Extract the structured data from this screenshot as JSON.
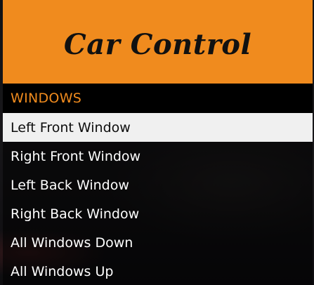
{
  "menu": {
    "title": "Car Control",
    "subtitle": "WINDOWS",
    "selected_index": 0,
    "items": [
      {
        "label": "Left Front Window"
      },
      {
        "label": "Right Front Window"
      },
      {
        "label": "Left Back Window"
      },
      {
        "label": "Right Back Window"
      },
      {
        "label": "All Windows Down"
      },
      {
        "label": "All Windows Up"
      }
    ]
  },
  "colors": {
    "accent": "#f08b1e",
    "header_text": "#111111",
    "selected_bg": "#f0f0f0",
    "item_text": "#ffffff"
  }
}
